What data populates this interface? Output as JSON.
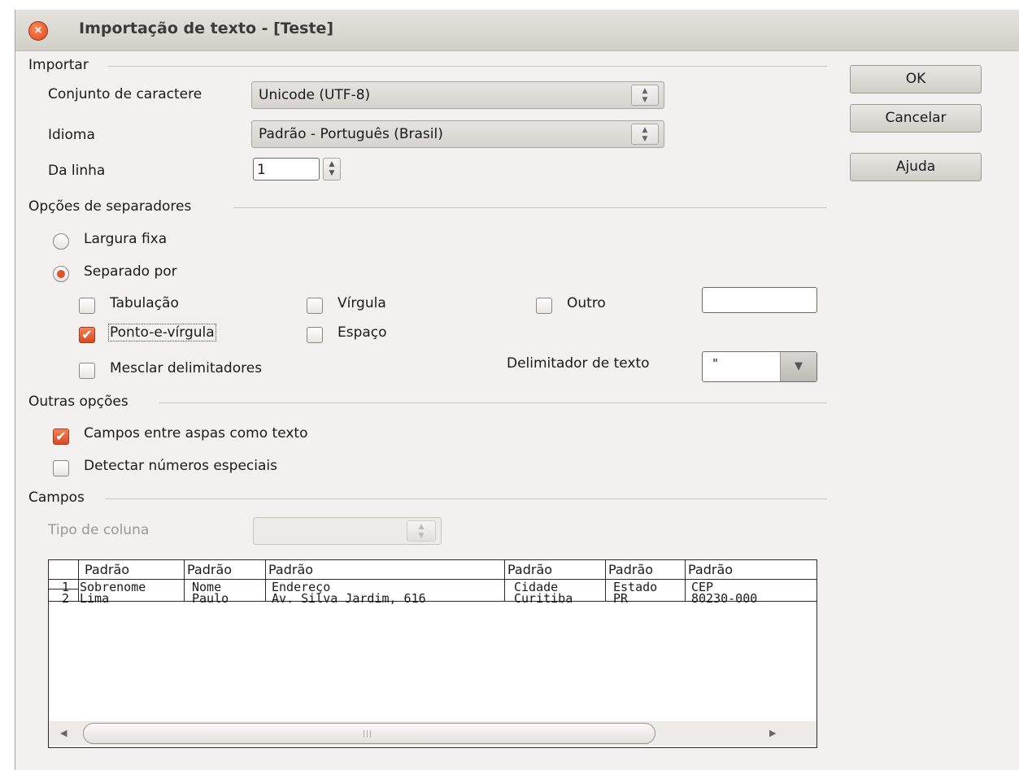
{
  "window": {
    "title": "Importação de texto - [Teste]",
    "close_glyph": "×"
  },
  "importar": {
    "heading": "Importar",
    "charset_label": "Conjunto de caractere",
    "charset_value": "Unicode (UTF-8)",
    "language_label": "Idioma",
    "language_value": "Padrão - Português (Brasil)",
    "from_row_label": "Da linha",
    "from_row_value": "1"
  },
  "separators": {
    "heading": "Opções de separadores",
    "fixed_width": "Largura fixa",
    "separated_by": "Separado por",
    "tab": "Tabulação",
    "comma": "Vírgula",
    "other": "Outro",
    "semicolon": "Ponto-e-vírgula",
    "space": "Espaço",
    "merge": "Mesclar delimitadores",
    "text_delimiter_label": "Delimitador de texto",
    "text_delimiter_value": "\""
  },
  "other_options": {
    "heading": "Outras opções",
    "quoted_as_text": "Campos entre aspas como texto",
    "detect_special": "Detectar números especiais"
  },
  "fields": {
    "heading": "Campos",
    "column_type_label": "Tipo de coluna",
    "headers": [
      "Padrão",
      "Padrão",
      "Padrão",
      "Padrão",
      "Padrão",
      "Padrão"
    ],
    "rows": [
      {
        "num": "1",
        "cells": [
          "Sobrenome",
          "Nome",
          "Endereço",
          "Cidade",
          "Estado",
          "CEP"
        ]
      },
      {
        "num": "2",
        "cells": [
          "Lima",
          "Paulo",
          "Av. Silva Jardim, 616",
          "Curitiba",
          "PR",
          "80230-000"
        ]
      }
    ]
  },
  "buttons": {
    "ok": "OK",
    "cancel": "Cancelar",
    "help": "Ajuda"
  },
  "colors": {
    "accent": "#e0522a",
    "window_bg": "#f2f1f0"
  }
}
